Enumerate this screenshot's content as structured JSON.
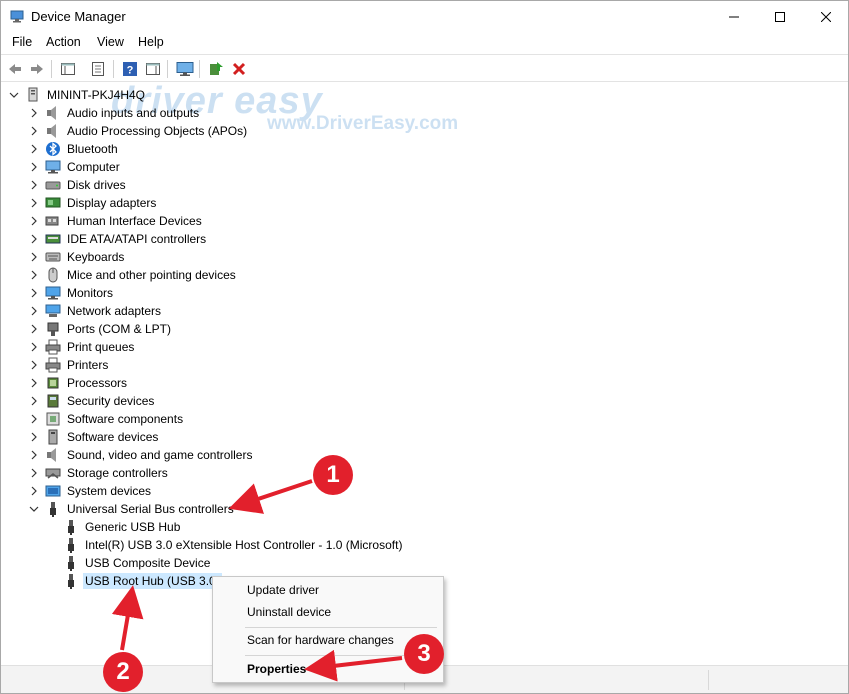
{
  "window": {
    "title": "Device Manager"
  },
  "menu": [
    "File",
    "Action",
    "View",
    "Help"
  ],
  "toolbar_icons": [
    "back-arrow-icon",
    "forward-arrow-icon",
    "show-hide-console-tree-icon",
    "properties-icon",
    "help-icon",
    "action-pane-icon",
    "monitor-icon",
    "update-driver-icon",
    "uninstall-icon"
  ],
  "tree": {
    "root": "MININT-PKJ4H4Q",
    "categories": [
      {
        "label": "Audio inputs and outputs",
        "icon": "speaker-icon"
      },
      {
        "label": "Audio Processing Objects (APOs)",
        "icon": "speaker-icon"
      },
      {
        "label": "Bluetooth",
        "icon": "bluetooth-icon"
      },
      {
        "label": "Computer",
        "icon": "computer-icon"
      },
      {
        "label": "Disk drives",
        "icon": "disk-drive-icon"
      },
      {
        "label": "Display adapters",
        "icon": "display-adapter-icon"
      },
      {
        "label": "Human Interface Devices",
        "icon": "hid-icon"
      },
      {
        "label": "IDE ATA/ATAPI controllers",
        "icon": "ide-controller-icon"
      },
      {
        "label": "Keyboards",
        "icon": "keyboard-icon"
      },
      {
        "label": "Mice and other pointing devices",
        "icon": "mouse-icon"
      },
      {
        "label": "Monitors",
        "icon": "monitor-icon"
      },
      {
        "label": "Network adapters",
        "icon": "network-adapter-icon"
      },
      {
        "label": "Ports (COM & LPT)",
        "icon": "port-icon"
      },
      {
        "label": "Print queues",
        "icon": "printer-icon"
      },
      {
        "label": "Printers",
        "icon": "printer-icon"
      },
      {
        "label": "Processors",
        "icon": "processor-icon"
      },
      {
        "label": "Security devices",
        "icon": "security-device-icon"
      },
      {
        "label": "Software components",
        "icon": "software-component-icon"
      },
      {
        "label": "Software devices",
        "icon": "software-device-icon"
      },
      {
        "label": "Sound, video and game controllers",
        "icon": "speaker-icon"
      },
      {
        "label": "Storage controllers",
        "icon": "storage-controller-icon"
      },
      {
        "label": "System devices",
        "icon": "system-device-icon"
      },
      {
        "label": "Universal Serial Bus controllers",
        "icon": "usb-icon"
      }
    ],
    "usb_children": [
      "Generic USB Hub",
      "Intel(R) USB 3.0 eXtensible Host Controller - 1.0 (Microsoft)",
      "USB Composite Device",
      "USB Root Hub (USB 3.0)"
    ]
  },
  "context_menu": {
    "update_driver": "Update driver",
    "uninstall_device": "Uninstall device",
    "scan": "Scan for hardware changes",
    "properties": "Properties"
  },
  "watermark": {
    "main": "driver easy",
    "sub": "www.DriverEasy.com"
  },
  "annotations": {
    "step1": "1",
    "step2": "2",
    "step3": "3",
    "color": "#e2202c"
  }
}
